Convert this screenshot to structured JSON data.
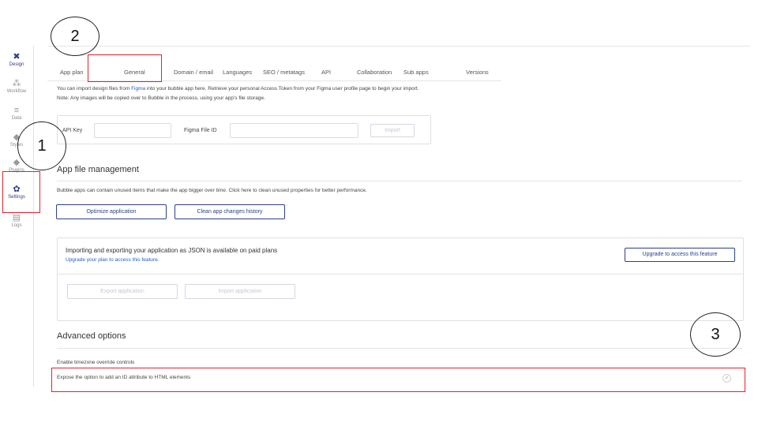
{
  "sidebar": {
    "items": [
      {
        "label": "Design",
        "icon": "design-icon",
        "glyph": "✖"
      },
      {
        "label": "Workflow",
        "icon": "workflow-icon",
        "glyph": "⁂"
      },
      {
        "label": "Data",
        "icon": "database-icon",
        "glyph": "≡"
      },
      {
        "label": "Styles",
        "icon": "styles-icon",
        "glyph": "◆"
      },
      {
        "label": "Plugins",
        "icon": "plugins-icon",
        "glyph": "◆"
      },
      {
        "label": "Settings",
        "icon": "gear-icon",
        "glyph": "✿"
      },
      {
        "label": "Logs",
        "icon": "logs-icon",
        "glyph": "▤"
      }
    ]
  },
  "tabs": [
    {
      "label": "App plan"
    },
    {
      "label": "General"
    },
    {
      "label": "Domain / email"
    },
    {
      "label": "Languages"
    },
    {
      "label": "SEO / metatags"
    },
    {
      "label": "API"
    },
    {
      "label": "Collaboration"
    },
    {
      "label": "Sub apps"
    },
    {
      "label": "Versions"
    }
  ],
  "figma": {
    "intro_before": "You can import design files from ",
    "intro_link": "Figma",
    "intro_after": " into your bubble app here. Retrieve your personal Access Token from your Figma user profile page to begin your import.",
    "note": "Note: Any images will be copied over to Bubble in the process, using your app's file storage.",
    "api_key_label": "API Key",
    "file_id_label": "Figma File ID",
    "import_label": "Import"
  },
  "file_mgmt": {
    "title": "App file management",
    "description": "Bubble apps can contain unused items that make the app bigger over time. Click here to clean unused properties for better performance.",
    "optimize_label": "Optimize application",
    "clean_label": "Clean app changes history"
  },
  "json_box": {
    "title": "Importing and exporting your application as JSON is available on paid plans",
    "upgrade_link": "Upgrade your plan to access this feature.",
    "upgrade_button": "Upgrade to access this feature",
    "export_label": "Export application",
    "import_label": "Import application"
  },
  "advanced": {
    "title": "Advanced options",
    "timezone_label": "Enable timezone override controls",
    "expose_id_label": "Expose the option to add an ID attribute to HTML elements",
    "expose_id_checked": true
  },
  "annotations": [
    "2",
    "1",
    "3"
  ],
  "colors": {
    "accent": "#2c3e8c",
    "link": "#1f5fbf",
    "annotation_red": "#e8202a"
  }
}
